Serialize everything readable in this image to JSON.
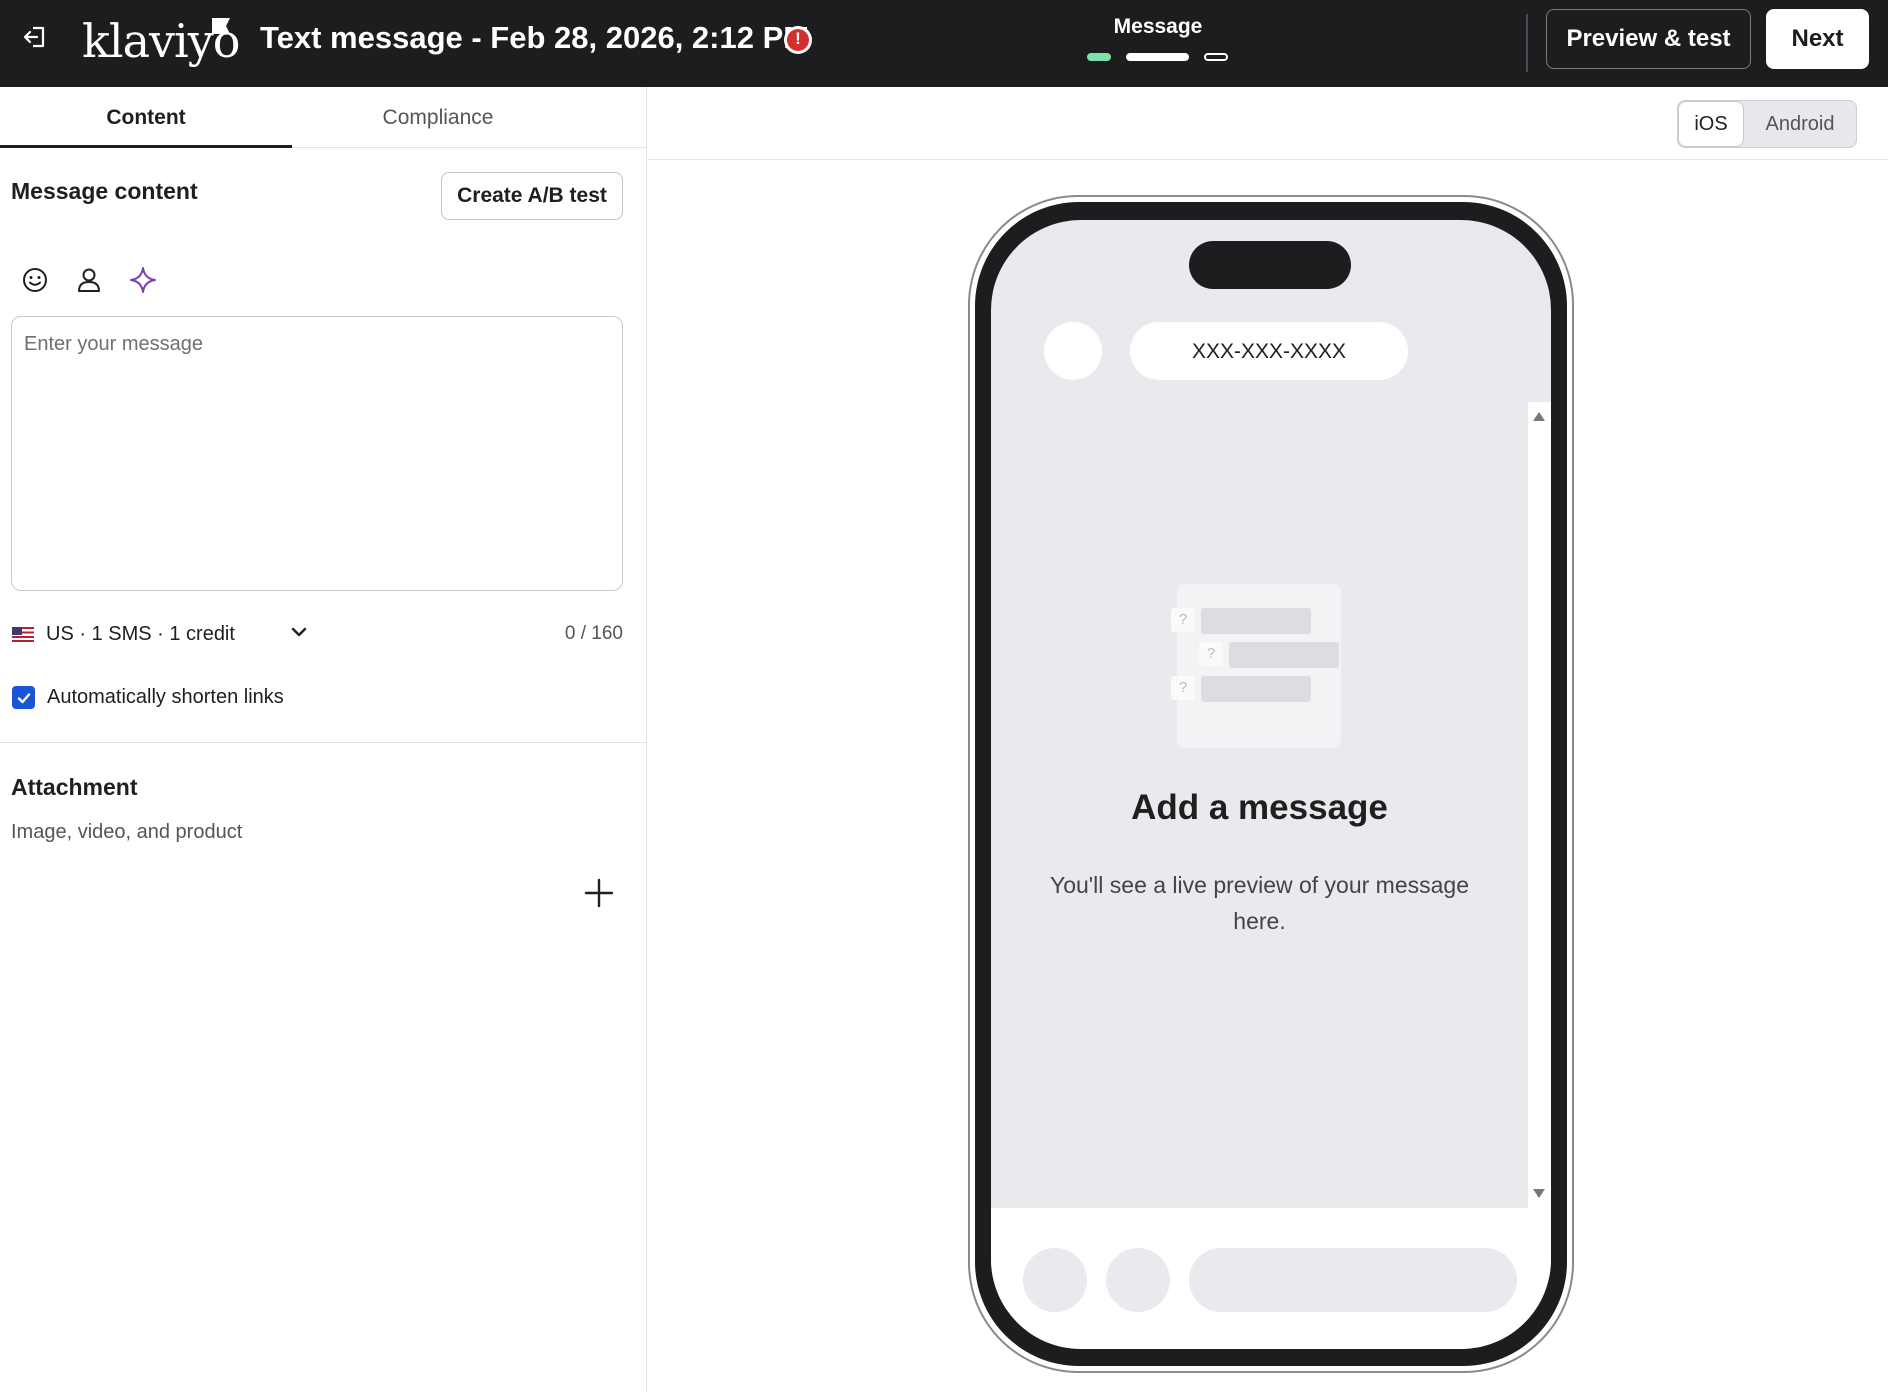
{
  "header": {
    "exit_icon": "exit-icon",
    "logo_text": "klaviyo",
    "title": "Text message - Feb 28, 2026, 2:12 PM",
    "error_icon": "alert-circle-icon",
    "error_mark": "!",
    "step_label": "Message",
    "step_progress": {
      "total": 3,
      "current": 2
    },
    "step_colors": {
      "complete": "#7fe0a8",
      "current": "#ffffff"
    },
    "preview_button": "Preview & test",
    "next_button": "Next",
    "background": "#1c1d1f"
  },
  "left_panel": {
    "tabs": [
      {
        "label": "Content",
        "active": true
      },
      {
        "label": "Compliance",
        "active": false
      }
    ],
    "message_content": {
      "title": "Message content",
      "ab_button": "Create A/B test",
      "toolbar_icons": [
        "emoji-icon",
        "person-icon",
        "sparkle-icon"
      ],
      "placeholder": "Enter your message",
      "value": "",
      "country_selector": "US · 1 SMS · 1 credit",
      "flag_icon": "us-flag-icon",
      "char_count": "0 / 160",
      "shorten_links_label": "Automatically shorten links",
      "shorten_links_checked": true,
      "accent": "#1b55d6"
    },
    "attachment": {
      "title": "Attachment",
      "subtitle": "Image, video, and product",
      "add_icon": "plus-icon"
    }
  },
  "preview": {
    "platform_options": [
      "iOS",
      "Android"
    ],
    "selected_platform": "iOS",
    "phone_number": "XXX-XXX-XXXX",
    "empty_title": "Add a message",
    "empty_subtitle": "You'll see a live preview of your message here.",
    "illustration_mark": "?"
  }
}
